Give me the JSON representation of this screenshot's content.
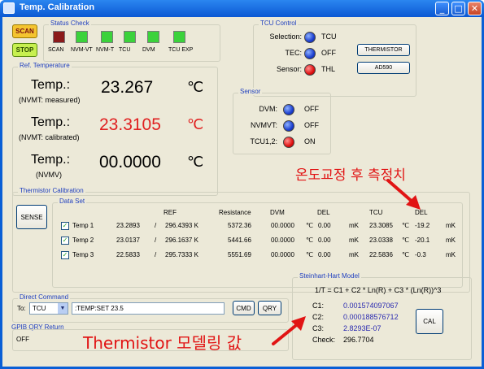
{
  "window": {
    "title": "Temp. Calibration",
    "controls": [
      "_",
      "□",
      "✕"
    ]
  },
  "top_buttons": {
    "scan": "SCAN",
    "stop": "STOP",
    "scan_color": "#f4c430",
    "stop_color": "#c7f050"
  },
  "status": {
    "title": "Status Check",
    "items": [
      {
        "label": "SCAN",
        "color": "#8b1a1a"
      },
      {
        "label": "NVM-VT",
        "color": "#3bd23b"
      },
      {
        "label": "NVM-T",
        "color": "#3bd23b"
      },
      {
        "label": "TCU",
        "color": "#3bd23b"
      },
      {
        "label": "DVM",
        "color": "#3bd23b"
      },
      {
        "label": "TCU EXP",
        "color": "#3bd23b"
      }
    ]
  },
  "tcu": {
    "title": "TCU Control",
    "rows": [
      {
        "label": "Selection:",
        "state": "blue",
        "value": "TCU"
      },
      {
        "label": "TEC:",
        "state": "blue",
        "value": "OFF"
      },
      {
        "label": "Sensor:",
        "state": "red",
        "value": "THL"
      }
    ],
    "btn_thermistor": "THERMISTOR",
    "btn_ad590": "AD590"
  },
  "ref": {
    "title": "Ref. Temperature",
    "rows": [
      {
        "label": "Temp.:",
        "sub": "(NVMT: measured)",
        "value": "23.267",
        "unit": "℃",
        "color": "#000000"
      },
      {
        "label": "Temp.:",
        "sub": "(NVMT: calibrated)",
        "value": "23.3105",
        "unit": "℃",
        "color": "#e02020"
      },
      {
        "label": "Temp.:",
        "sub": "(NVMV)",
        "value": "00.0000",
        "unit": "℃",
        "color": "#000000"
      }
    ]
  },
  "sensor": {
    "title": "Sensor",
    "rows": [
      {
        "label": "DVM:",
        "state": "blue",
        "value": "OFF"
      },
      {
        "label": "NVMVT:",
        "state": "blue",
        "value": "OFF"
      },
      {
        "label": "TCU1,2:",
        "state": "red",
        "value": "ON"
      }
    ]
  },
  "calib": {
    "title": "Thermistor Calibration",
    "sense": "SENSE",
    "dataset_title": "Data Set",
    "headers": {
      "ref": "REF",
      "res": "Resistance",
      "dvm": "DVM",
      "del1": "DEL",
      "tcu": "TCU",
      "del2": "DEL"
    },
    "rows": [
      {
        "name": "Temp 1",
        "v": "23.2893",
        "sep": "/",
        "k": "296.4393 K",
        "res": "5372.36",
        "dvm": "00.0000",
        "u1": "℃",
        "del": "0.00",
        "mk1": "mK",
        "tcu": "23.3085",
        "u2": "℃",
        "del2": "-19.2",
        "mk2": "mK"
      },
      {
        "name": "Temp 2",
        "v": "23.0137",
        "sep": "/",
        "k": "296.1637 K",
        "res": "5441.66",
        "dvm": "00.0000",
        "u1": "℃",
        "del": "0.00",
        "mk1": "mK",
        "tcu": "23.0338",
        "u2": "℃",
        "del2": "-20.1",
        "mk2": "mK"
      },
      {
        "name": "Temp 3",
        "v": "22.5833",
        "sep": "/",
        "k": "295.7333 K",
        "res": "5551.69",
        "dvm": "00.0000",
        "u1": "℃",
        "del": "0.00",
        "mk1": "mK",
        "tcu": "22.5836",
        "u2": "℃",
        "del2": "-0.3",
        "mk2": "mK"
      }
    ]
  },
  "direct": {
    "title": "Direct Command",
    "to_label": "To:",
    "to_value": "TCU",
    "command": ":TEMP:SET 23.5",
    "cmd": "CMD",
    "qry": "QRY"
  },
  "gpib": {
    "title": "GPIB QRY Return",
    "value": "OFF"
  },
  "sh": {
    "title": "Steinhart-Hart Model",
    "formula": "1/T = C1 + C2 * Ln(R) + C3 * (Ln(R))^3",
    "c1_label": "C1:",
    "c1": "0.001574097067",
    "c2_label": "C2:",
    "c2": "0.000188576712",
    "c3_label": "C3:",
    "c3": "2.8293E-07",
    "check_label": "Check:",
    "check": "296.7704",
    "cal": "CAL"
  },
  "annotations": {
    "top": "온도교정 후 측정치",
    "bottom": "Thermistor 모델링 값",
    "color": "#e11414"
  }
}
